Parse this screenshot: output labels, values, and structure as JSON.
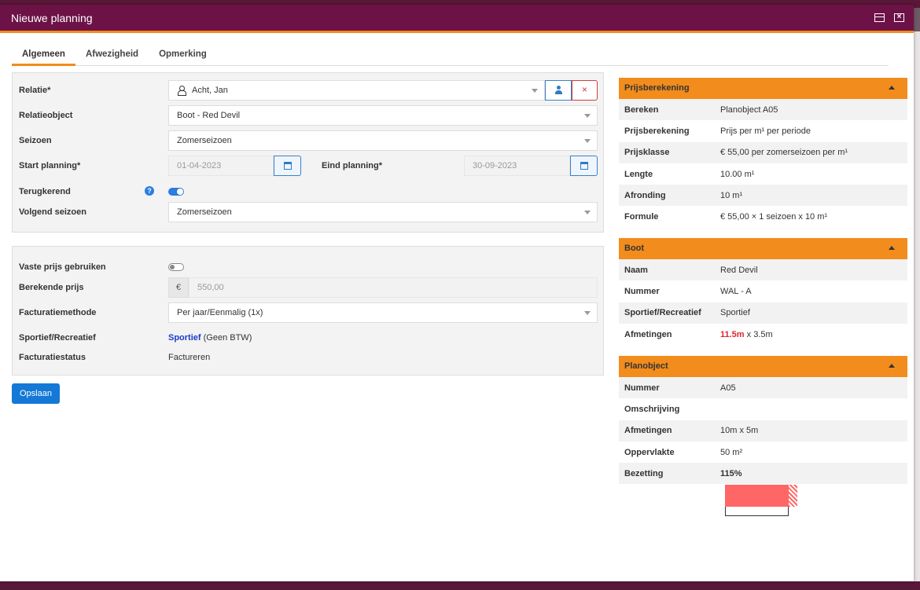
{
  "window": {
    "title": "Nieuwe planning"
  },
  "tabs": [
    {
      "label": "Algemeen",
      "active": true
    },
    {
      "label": "Afwezigheid",
      "active": false
    },
    {
      "label": "Opmerking",
      "active": false
    }
  ],
  "form": {
    "relatie": {
      "label": "Relatie*",
      "value": "Acht, Jan"
    },
    "relatieobject": {
      "label": "Relatieobject",
      "value": "Boot - Red Devil"
    },
    "seizoen": {
      "label": "Seizoen",
      "value": "Zomerseizoen"
    },
    "start_planning": {
      "label": "Start planning*",
      "value": "01-04-2023"
    },
    "eind_planning": {
      "label": "Eind planning*",
      "value": "30-09-2023"
    },
    "terugkerend": {
      "label": "Terugkerend",
      "help": "?",
      "on": true
    },
    "volgend_seizoen": {
      "label": "Volgend seizoen",
      "value": "Zomerseizoen"
    },
    "vaste_prijs": {
      "label": "Vaste prijs gebruiken",
      "on": false
    },
    "berekende_prijs": {
      "label": "Berekende prijs",
      "currency": "€",
      "value": "550,00"
    },
    "facturatiemethode": {
      "label": "Facturatiemethode",
      "value": "Per jaar/Eenmalig (1x)"
    },
    "sportief_recreatief": {
      "label": "Sportief/Recreatief",
      "value": "Sportief",
      "note": "(Geen BTW)"
    },
    "facturatiestatus": {
      "label": "Facturatiestatus",
      "value": "Factureren"
    },
    "save_label": "Opslaan"
  },
  "prijsberekening": {
    "title": "Prijsberekening",
    "rows": [
      {
        "key": "Bereken",
        "value": "Planobject A05"
      },
      {
        "key": "Prijsberekening",
        "value": "Prijs per m¹ per periode"
      },
      {
        "key": "Prijsklasse",
        "value": "€ 55,00 per zomerseizoen per m¹"
      },
      {
        "key": "Lengte",
        "value": "10.00 m¹"
      },
      {
        "key": "Afronding",
        "value": "10 m¹"
      },
      {
        "key": "Formule",
        "value": "€ 55,00 × 1 seizoen x 10 m¹"
      }
    ]
  },
  "boot": {
    "title": "Boot",
    "naam": {
      "key": "Naam",
      "value": "Red Devil"
    },
    "nummer": {
      "key": "Nummer",
      "value": "WAL - A"
    },
    "sportief": {
      "key": "Sportief/Recreatief",
      "value": "Sportief"
    },
    "afmetingen": {
      "key": "Afmetingen",
      "length": "11.5m",
      "rest": "x 3.5m"
    }
  },
  "planobject": {
    "title": "Planobject",
    "nummer": {
      "key": "Nummer",
      "value": "A05"
    },
    "omschrijving": {
      "key": "Omschrijving",
      "value": ""
    },
    "afmetingen": {
      "key": "Afmetingen",
      "value": "10m x 5m"
    },
    "oppervlakte": {
      "key": "Oppervlakte",
      "value": "50 m²"
    },
    "bezetting": {
      "key": "Bezetting",
      "value": "115%",
      "fraction": 1.15
    }
  },
  "colors": {
    "accent": "#f28c1c",
    "titlebar": "#6d1247",
    "primary": "#1478d6",
    "danger": "#e0262b"
  }
}
